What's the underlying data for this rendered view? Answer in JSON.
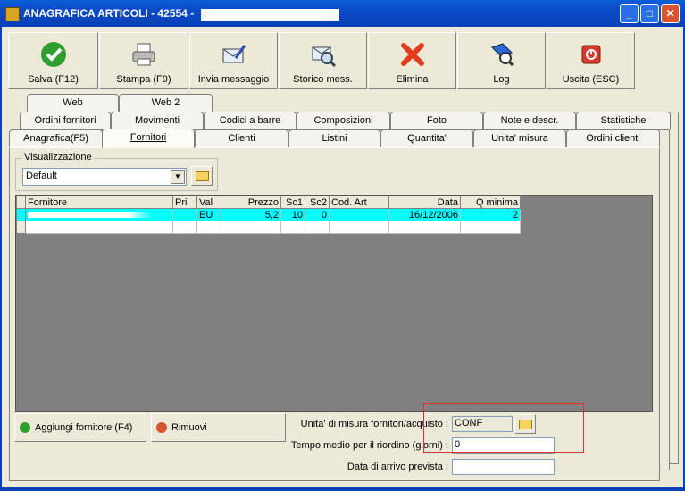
{
  "window": {
    "title": "ANAGRAFICA ARTICOLI - 42554 -",
    "min": "_",
    "max": "□",
    "close": "✕"
  },
  "toolbar": [
    {
      "label": "Salva (F12)",
      "icon": "check-icon"
    },
    {
      "label": "Stampa (F9)",
      "icon": "printer-icon"
    },
    {
      "label": "Invia messaggio",
      "icon": "envelope-pen-icon"
    },
    {
      "label": "Storico mess.",
      "icon": "envelope-search-icon"
    },
    {
      "label": "Elimina",
      "icon": "red-x-icon"
    },
    {
      "label": "Log",
      "icon": "log-icon"
    },
    {
      "label": "Uscita (ESC)",
      "icon": "exit-icon"
    }
  ],
  "tabs": {
    "row1": [
      "Web",
      "Web 2"
    ],
    "row2": [
      "Ordini fornitori",
      "Movimenti",
      "Codici a barre",
      "Composizioni",
      "Foto",
      "Note e descr.",
      "Statistiche"
    ],
    "row3": [
      "Anagrafica(F5)",
      "Fornitori",
      "Clienti",
      "Listini",
      "Quantita'",
      "Unita' misura",
      "Ordini clienti"
    ],
    "active": "Fornitori"
  },
  "view": {
    "label": "Visualizzazione",
    "value": "Default"
  },
  "grid": {
    "headers": [
      "Fornitore",
      "Pri",
      "Val",
      "Prezzo",
      "Sc1",
      "Sc2",
      "Cod. Art",
      "Data",
      "Q minima"
    ],
    "rows": [
      {
        "fornitore": "",
        "pri": "",
        "val": "EU",
        "prezzo": "5,2",
        "sc1": "10",
        "sc2": "0",
        "cod": "",
        "data": "16/12/2006",
        "qmin": "2"
      }
    ]
  },
  "buttons": {
    "add": "Aggiungi fornitore (F4)",
    "remove": "Rimuovi"
  },
  "fields": {
    "um_label": "Unita' di misura fornitori/acquisto :",
    "um_value": "CONF",
    "tempo_label": "Tempo medio per il riordino (giorni) :",
    "tempo_value": "0",
    "data_label": "Data di arrivo prevista :",
    "data_value": ""
  },
  "colors": {
    "titlebar": "#0b49c5",
    "selected_row": "#00ffff",
    "highlight_box": "#e03030"
  }
}
